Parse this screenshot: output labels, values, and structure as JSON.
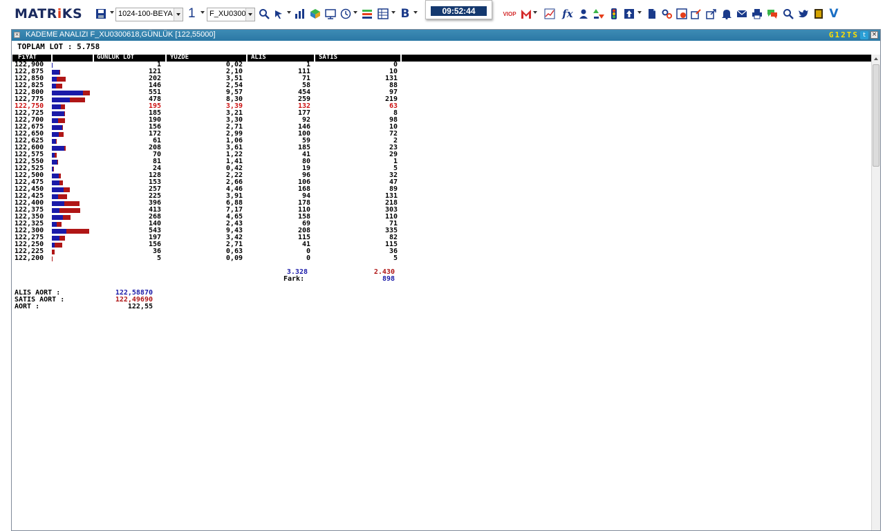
{
  "toolbar": {
    "logo_main": "MATR",
    "logo_dot": "i",
    "logo_tail": "KS",
    "layout_select": "1024-100-BEYA",
    "number_label": "1",
    "symbol_select": "F_XU0300",
    "letter_b": "B",
    "viop_label": "VIOP",
    "fx_label": "fx",
    "v_label": "V",
    "clock": "09:52:44"
  },
  "window": {
    "title": "KADEME ANALIZI F_XU0300618,GÜNLÜK [122,55000]",
    "tags": "G12TS",
    "total_lot": "TOPLAM LOT : 5.758",
    "headers": {
      "price": "FiYAT",
      "lot": "GUNLUK LOT",
      "pct": "YUZDE",
      "buy": "ALIS",
      "sell": "SATIS"
    },
    "rows": [
      {
        "price": "122,900",
        "lot": "1",
        "pct": "0,02",
        "buy": "1",
        "sell": "0",
        "buy_n": 1,
        "sell_n": 0
      },
      {
        "price": "122,875",
        "lot": "121",
        "pct": "2,10",
        "buy": "111",
        "sell": "10",
        "buy_n": 111,
        "sell_n": 10
      },
      {
        "price": "122,850",
        "lot": "202",
        "pct": "3,51",
        "buy": "71",
        "sell": "131",
        "buy_n": 71,
        "sell_n": 131
      },
      {
        "price": "122,825",
        "lot": "146",
        "pct": "2,54",
        "buy": "58",
        "sell": "88",
        "buy_n": 58,
        "sell_n": 88
      },
      {
        "price": "122,800",
        "lot": "551",
        "pct": "9,57",
        "buy": "454",
        "sell": "97",
        "buy_n": 454,
        "sell_n": 97
      },
      {
        "price": "122,775",
        "lot": "478",
        "pct": "8,30",
        "buy": "259",
        "sell": "219",
        "buy_n": 259,
        "sell_n": 219
      },
      {
        "price": "122,750",
        "lot": "195",
        "pct": "3,39",
        "buy": "132",
        "sell": "63",
        "buy_n": 132,
        "sell_n": 63,
        "highlight": true
      },
      {
        "price": "122,725",
        "lot": "185",
        "pct": "3,21",
        "buy": "177",
        "sell": "8",
        "buy_n": 177,
        "sell_n": 8
      },
      {
        "price": "122,700",
        "lot": "190",
        "pct": "3,30",
        "buy": "92",
        "sell": "98",
        "buy_n": 92,
        "sell_n": 98
      },
      {
        "price": "122,675",
        "lot": "156",
        "pct": "2,71",
        "buy": "146",
        "sell": "10",
        "buy_n": 146,
        "sell_n": 10
      },
      {
        "price": "122,650",
        "lot": "172",
        "pct": "2,99",
        "buy": "100",
        "sell": "72",
        "buy_n": 100,
        "sell_n": 72
      },
      {
        "price": "122,625",
        "lot": "61",
        "pct": "1,06",
        "buy": "59",
        "sell": "2",
        "buy_n": 59,
        "sell_n": 2
      },
      {
        "price": "122,600",
        "lot": "208",
        "pct": "3,61",
        "buy": "185",
        "sell": "23",
        "buy_n": 185,
        "sell_n": 23
      },
      {
        "price": "122,575",
        "lot": "70",
        "pct": "1,22",
        "buy": "41",
        "sell": "29",
        "buy_n": 41,
        "sell_n": 29
      },
      {
        "price": "122,550",
        "lot": "81",
        "pct": "1,41",
        "buy": "80",
        "sell": "1",
        "buy_n": 80,
        "sell_n": 1
      },
      {
        "price": "122,525",
        "lot": "24",
        "pct": "0,42",
        "buy": "19",
        "sell": "5",
        "buy_n": 19,
        "sell_n": 5
      },
      {
        "price": "122,500",
        "lot": "128",
        "pct": "2,22",
        "buy": "96",
        "sell": "32",
        "buy_n": 96,
        "sell_n": 32
      },
      {
        "price": "122,475",
        "lot": "153",
        "pct": "2,66",
        "buy": "106",
        "sell": "47",
        "buy_n": 106,
        "sell_n": 47
      },
      {
        "price": "122,450",
        "lot": "257",
        "pct": "4,46",
        "buy": "168",
        "sell": "89",
        "buy_n": 168,
        "sell_n": 89
      },
      {
        "price": "122,425",
        "lot": "225",
        "pct": "3,91",
        "buy": "94",
        "sell": "131",
        "buy_n": 94,
        "sell_n": 131
      },
      {
        "price": "122,400",
        "lot": "396",
        "pct": "6,88",
        "buy": "178",
        "sell": "218",
        "buy_n": 178,
        "sell_n": 218
      },
      {
        "price": "122,375",
        "lot": "413",
        "pct": "7,17",
        "buy": "110",
        "sell": "303",
        "buy_n": 110,
        "sell_n": 303
      },
      {
        "price": "122,350",
        "lot": "268",
        "pct": "4,65",
        "buy": "158",
        "sell": "110",
        "buy_n": 158,
        "sell_n": 110
      },
      {
        "price": "122,325",
        "lot": "140",
        "pct": "2,43",
        "buy": "69",
        "sell": "71",
        "buy_n": 69,
        "sell_n": 71
      },
      {
        "price": "122,300",
        "lot": "543",
        "pct": "9,43",
        "buy": "208",
        "sell": "335",
        "buy_n": 208,
        "sell_n": 335
      },
      {
        "price": "122,275",
        "lot": "197",
        "pct": "3,42",
        "buy": "115",
        "sell": "82",
        "buy_n": 115,
        "sell_n": 82
      },
      {
        "price": "122,250",
        "lot": "156",
        "pct": "2,71",
        "buy": "41",
        "sell": "115",
        "buy_n": 41,
        "sell_n": 115
      },
      {
        "price": "122,225",
        "lot": "36",
        "pct": "0,63",
        "buy": "0",
        "sell": "36",
        "buy_n": 0,
        "sell_n": 36
      },
      {
        "price": "122,200",
        "lot": "5",
        "pct": "0,09",
        "buy": "0",
        "sell": "5",
        "buy_n": 0,
        "sell_n": 5
      }
    ],
    "totals": {
      "buy": "3.328",
      "sell": "2.430",
      "diff_label": "Fark:",
      "diff": "898"
    },
    "averages": {
      "buy_label": "ALIS AORT :",
      "buy_value": "122,58870",
      "sell_label": "SATIS AORT :",
      "sell_value": "122,49690",
      "avg_label": "AORT :",
      "avg_value": "122,55"
    }
  },
  "colors": {
    "buy_bar": "#1a1aa8",
    "sell_bar": "#b01616",
    "title_bar": "#2b78a5",
    "highlight_row": "#cc1111"
  }
}
